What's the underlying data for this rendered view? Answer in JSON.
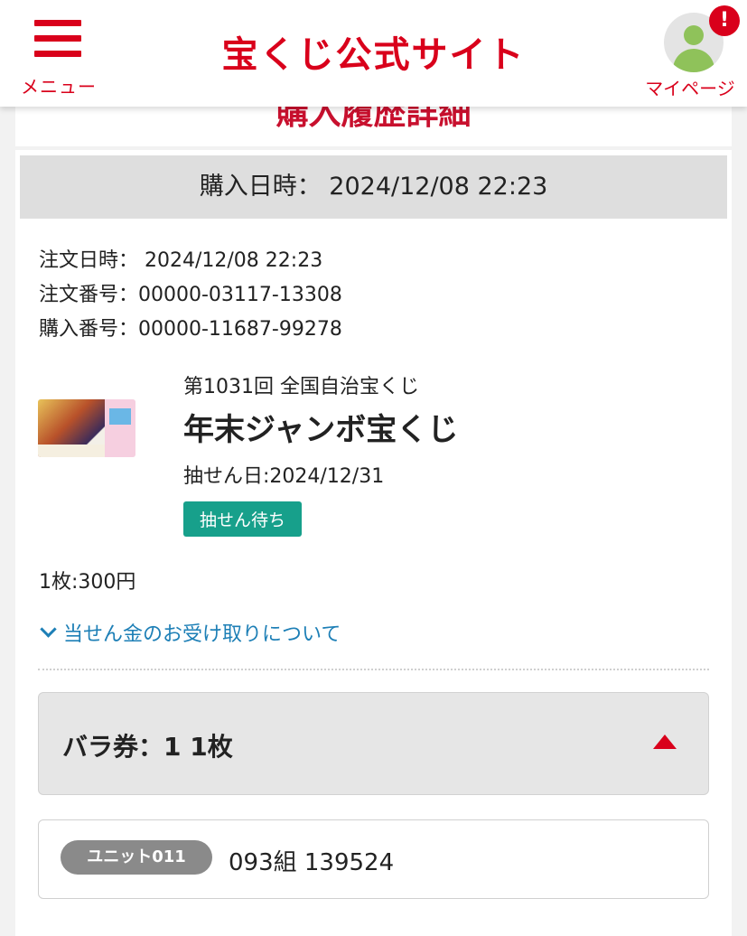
{
  "header": {
    "menu_label": "メニュー",
    "site_title": "宝くじ公式サイト",
    "mypage_label": "マイページ",
    "notification_badge": "!",
    "brand_color": "#d9001b"
  },
  "page": {
    "heading": "購入履歴詳細"
  },
  "purchase": {
    "purchase_datetime": "購入日時： 2024/12/08 22:23",
    "order_datetime": "注文日時： 2024/12/08 22:23",
    "order_number": "注文番号：00000-03117-13308",
    "purchase_number": "購入番号：00000-11687-99278"
  },
  "lottery": {
    "round": "第1031回 全国自治宝くじ",
    "name": "年末ジャンボ宝くじ",
    "draw_date": "抽せん日:2024/12/31",
    "status": "抽せん待ち",
    "status_color": "#17a08b",
    "price": "1枚:300円",
    "prize_link": "当せん金のお受け取りについて"
  },
  "tickets": {
    "section_label": "バラ券：1  1枚",
    "items": [
      {
        "unit": "ユニット011",
        "number": "093組  139524"
      }
    ]
  }
}
